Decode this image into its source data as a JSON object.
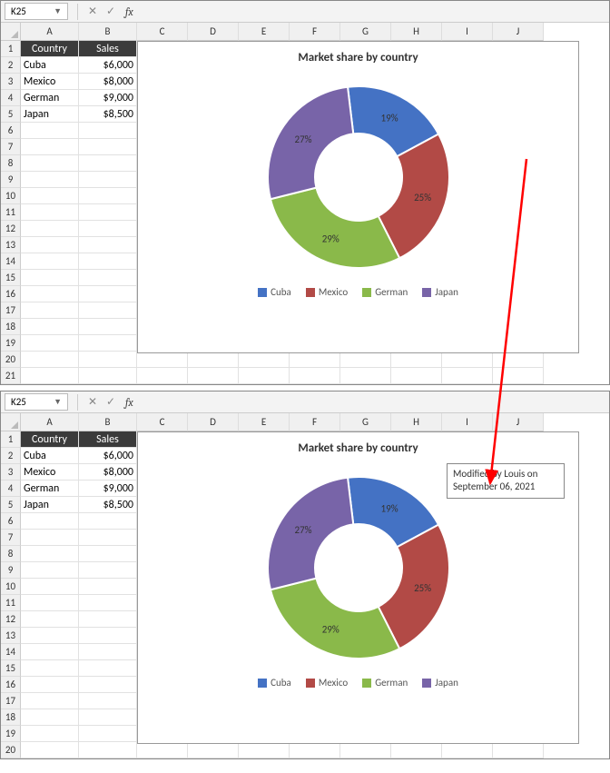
{
  "colWidths": {
    "A": 64,
    "B": 64,
    "C": 56,
    "D": 56,
    "E": 56,
    "F": 56,
    "G": 56,
    "H": 56,
    "I": 56,
    "J": 56
  },
  "columns": [
    "A",
    "B",
    "C",
    "D",
    "E",
    "F",
    "G",
    "H",
    "I",
    "J"
  ],
  "nameBox": "K25",
  "formula": "",
  "table": {
    "headers": [
      "Country",
      "Sales"
    ],
    "rows": [
      {
        "country": "Cuba",
        "sales": "$6,000"
      },
      {
        "country": "Mexico",
        "sales": "$8,000"
      },
      {
        "country": "German",
        "sales": "$9,000"
      },
      {
        "country": "Japan",
        "sales": "$8,500"
      }
    ]
  },
  "chart_data": {
    "type": "pie",
    "title": "Market share by country",
    "categories": [
      "Cuba",
      "Mexico",
      "German",
      "Japan"
    ],
    "values": [
      6000,
      8000,
      9000,
      8500
    ],
    "percentages": [
      19,
      25,
      29,
      27
    ],
    "colors": [
      "#4472c4",
      "#b24a46",
      "#8ab94a",
      "#7864a8"
    ],
    "legend_position": "bottom",
    "donut": true
  },
  "annotation": "Modified by Louis on September 06, 2021",
  "panel1_rows": 21,
  "panel2_rows": 20
}
